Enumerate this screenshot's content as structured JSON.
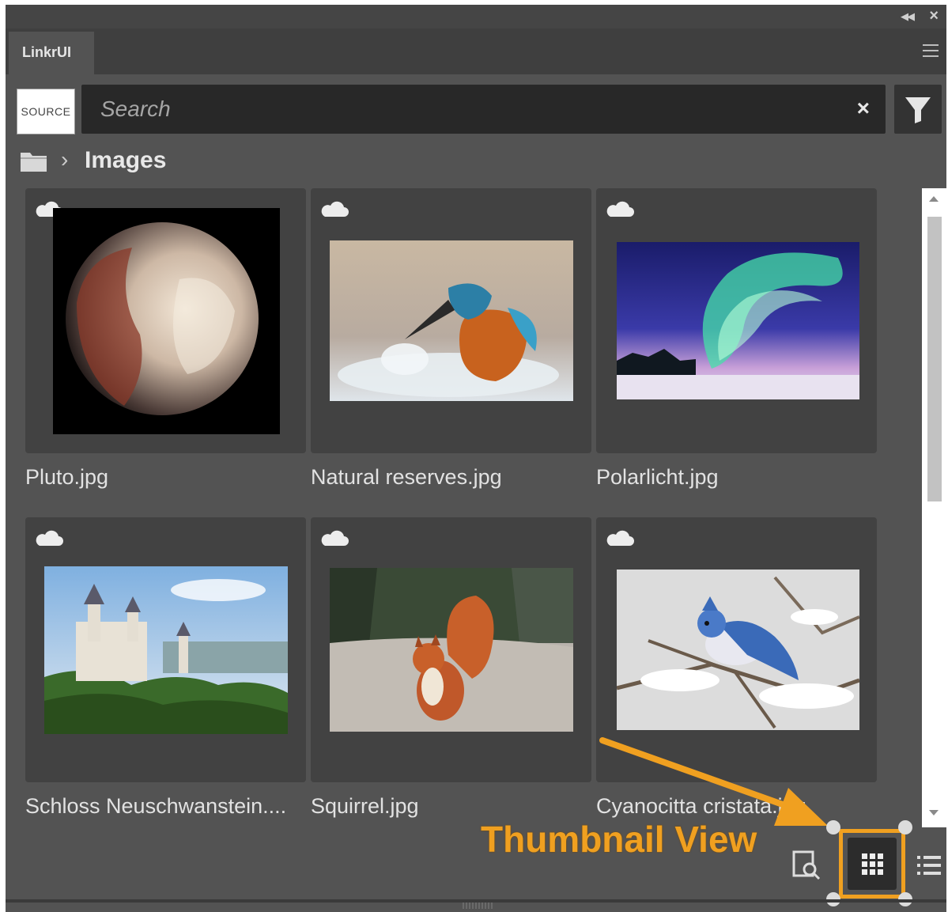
{
  "panel": {
    "tab_label": "LinkrUI"
  },
  "search": {
    "source_label": "SOURCE",
    "placeholder": "Search"
  },
  "breadcrumb": {
    "current": "Images"
  },
  "assets": [
    {
      "name": "Pluto.jpg",
      "cloud": true
    },
    {
      "name": "Natural reserves.jpg",
      "cloud": true
    },
    {
      "name": "Polarlicht.jpg",
      "cloud": true
    },
    {
      "name": "Schloss Neuschwanstein....",
      "cloud": true
    },
    {
      "name": "Squirrel.jpg",
      "cloud": true
    },
    {
      "name": "Cyanocitta cristata.jpg",
      "cloud": true
    }
  ],
  "annotation": {
    "text": "Thumbnail View",
    "color": "#f0a020"
  },
  "view": {
    "active_mode": "thumbnail"
  },
  "colors": {
    "panel_bg": "#535353",
    "card_bg": "#424242",
    "search_bg": "#282828",
    "accent": "#f0a020"
  },
  "icons": [
    "collapse-icon",
    "close-icon",
    "menu-icon",
    "clear-icon",
    "filter-icon",
    "folder-icon",
    "chevron-right-icon",
    "cloud-icon",
    "preview-icon",
    "grid-icon",
    "list-icon"
  ]
}
